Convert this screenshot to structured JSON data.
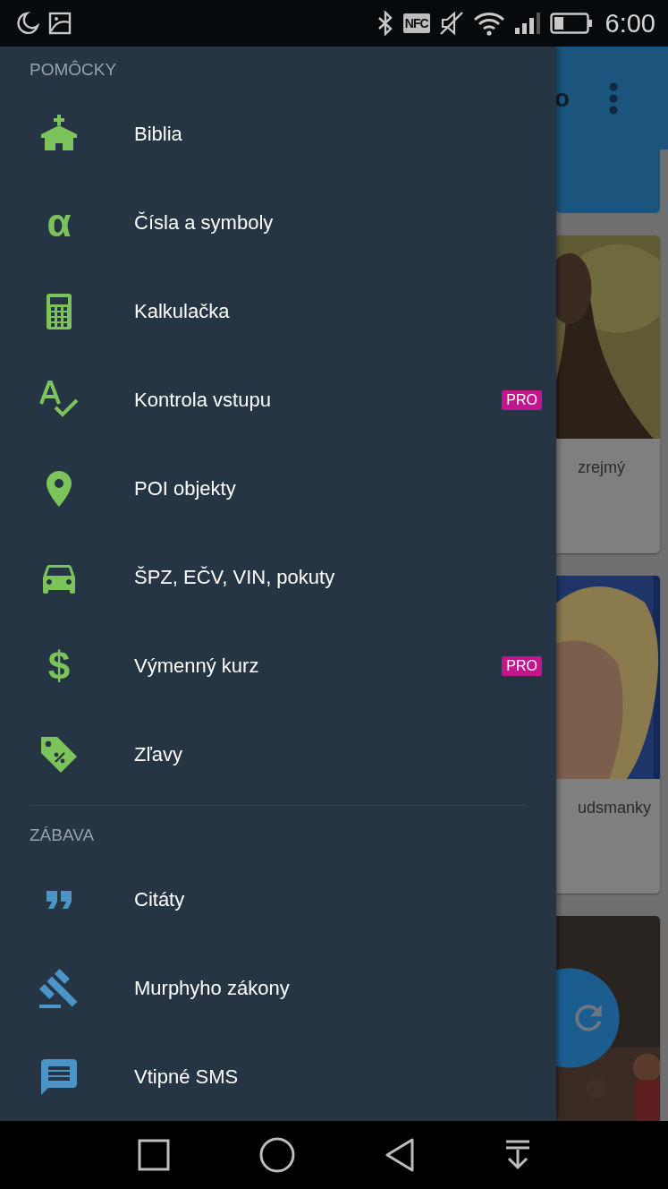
{
  "status_bar": {
    "nfc_label": "NFC",
    "time": "6:00"
  },
  "drawer": {
    "sections": [
      {
        "title": "POMÔCKY",
        "color": "#7dc35b",
        "items": [
          {
            "label": "Biblia"
          },
          {
            "label": "Čísla a symboly",
            "glyph": "α"
          },
          {
            "label": "Kalkulačka"
          },
          {
            "label": "Kontrola vstupu",
            "badge": "PRO"
          },
          {
            "label": "POI objekty"
          },
          {
            "label": "ŠPZ, EČV, VIN, pokuty"
          },
          {
            "label": "Výmenný kurz",
            "glyph": "$",
            "badge": "PRO"
          },
          {
            "label": "Zľavy"
          }
        ]
      },
      {
        "title": "ZÁBAVA",
        "color": "#4a94c7",
        "items": [
          {
            "label": "Citáty"
          },
          {
            "label": "Murphyho zákony"
          },
          {
            "label": "Vtipné SMS"
          }
        ]
      }
    ]
  },
  "background": {
    "toolbar_title": "o",
    "cards": [
      {
        "kind": "banner"
      },
      {
        "kind": "picture",
        "caption": "zrejmý"
      },
      {
        "kind": "picture",
        "caption": "udsmanky"
      },
      {
        "kind": "picture"
      }
    ]
  }
}
